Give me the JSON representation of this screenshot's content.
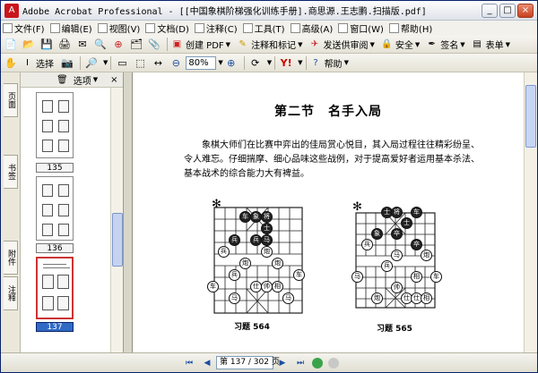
{
  "window": {
    "title": "Adobe Acrobat Professional - [[中国象棋阶梯强化训练手册].商思源.王志鹏.扫描版.pdf]",
    "app_icon": "acrobat-icon",
    "min_label": "_",
    "max_label": "□",
    "close_label": "×"
  },
  "menubar": {
    "items": [
      "文件(F)",
      "编辑(E)",
      "视图(V)",
      "文档(D)",
      "注释(C)",
      "工具(T)",
      "高级(A)",
      "窗口(W)",
      "帮助(H)"
    ]
  },
  "toolbar1": {
    "create_pdf": "创建 PDF",
    "comment_mark": "注释和标记",
    "send_review": "发送供审阅",
    "security": "安全",
    "sign": "签名",
    "forms": "表单"
  },
  "toolbar2": {
    "select": "选择",
    "zoom_value": "80%",
    "help": "帮助"
  },
  "rail": {
    "tabs": [
      "页面",
      "书签",
      "附件",
      "注释"
    ]
  },
  "panel": {
    "options_label": "选项",
    "close_label": "×",
    "thumbnails": [
      {
        "label": "135",
        "selected": false
      },
      {
        "label": "136",
        "selected": false
      },
      {
        "label": "137",
        "selected": true
      }
    ]
  },
  "document": {
    "heading": "第二节　名手入局",
    "paragraph": "象棋大师们在比赛中弈出的佳局赏心悦目，其入局过程往往精彩纷呈、令人难忘。仔细揣摩、细心品味这些战例，对于提高爱好者运用基本杀法、基本战术的综合能力大有裨益。",
    "exercises": [
      {
        "caption": "习题 564",
        "star": "✻"
      },
      {
        "caption": "习题 565",
        "star": "✻"
      }
    ],
    "board1_pieces": [
      "车",
      "象",
      "将",
      "士",
      "兵",
      "兵",
      "马",
      "兵",
      "炮",
      "炮",
      "炮",
      "仕",
      "帅",
      "兵",
      "相",
      "车",
      "马",
      "马",
      "车"
    ],
    "board2_pieces": [
      "士",
      "将",
      "车",
      "士",
      "象",
      "卒",
      "兵",
      "卒",
      "马",
      "炮",
      "兵",
      "相",
      "帅",
      "仕",
      "马",
      "车",
      "炮",
      "仕",
      "相"
    ]
  },
  "statusbar": {
    "page_display": "第 137 / 302 页"
  }
}
